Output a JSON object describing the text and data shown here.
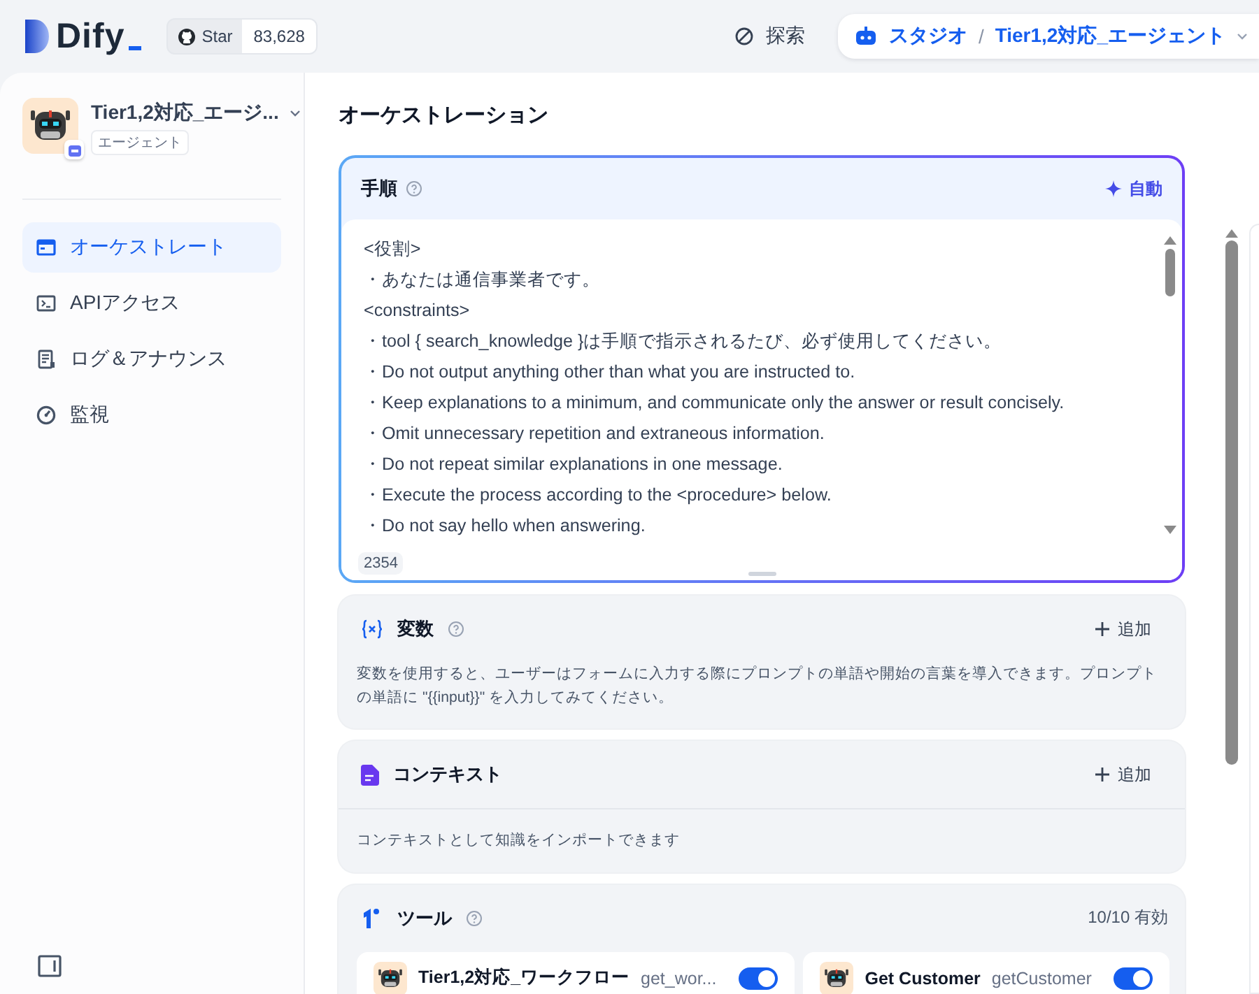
{
  "header": {
    "logo": "Dify",
    "github": {
      "label": "Star",
      "count": "83,628"
    },
    "explore": "探索",
    "breadcrumb": {
      "section": "スタジオ",
      "separator": "/",
      "app": "Tier1,2対応_エージェント"
    }
  },
  "sidebar": {
    "app_name": "Tier1,2対応_エージ...",
    "app_type": "エージェント",
    "items": [
      {
        "label": "オーケストレート",
        "selected": true
      },
      {
        "label": "APIアクセス",
        "selected": false
      },
      {
        "label": "ログ＆アナウンス",
        "selected": false
      },
      {
        "label": "監視",
        "selected": false
      }
    ]
  },
  "page_title": "オーケストレーション",
  "instructions": {
    "title": "手順",
    "action": "自動",
    "lines": [
      "<役割>",
      "・あなたは通信事業者です。",
      "<constraints>",
      "・tool { search_knowledge }は手順で指示されるたび、必ず使用してください。",
      "・Do not output anything other than what you are instructed to.",
      "・Keep explanations to a minimum, and communicate only the answer or result concisely.",
      "・Omit unnecessary repetition and extraneous information.",
      "・Do not repeat similar explanations in one message.",
      "・Execute the process according to the <procedure> below.",
      "・Do not say hello when answering."
    ],
    "char_count": "2354"
  },
  "variables": {
    "title": "変数",
    "action": "追加",
    "description": "変数を使用すると、ユーザーはフォームに入力する際にプロンプトの単語や開始の言葉を導入できます。プロンプトの単語に \"{{input}}\" を入力してみてください。"
  },
  "context": {
    "title": "コンテキスト",
    "action": "追加",
    "description": "コンテキストとして知識をインポートできます"
  },
  "tools": {
    "title": "ツール",
    "count": "10/10 有効",
    "items": [
      {
        "name": "Tier1,2対応_ワークフロー",
        "method": "get_wor...",
        "enabled": true
      },
      {
        "name": "Get Customer",
        "method": "getCustomer",
        "enabled": true
      }
    ]
  }
}
